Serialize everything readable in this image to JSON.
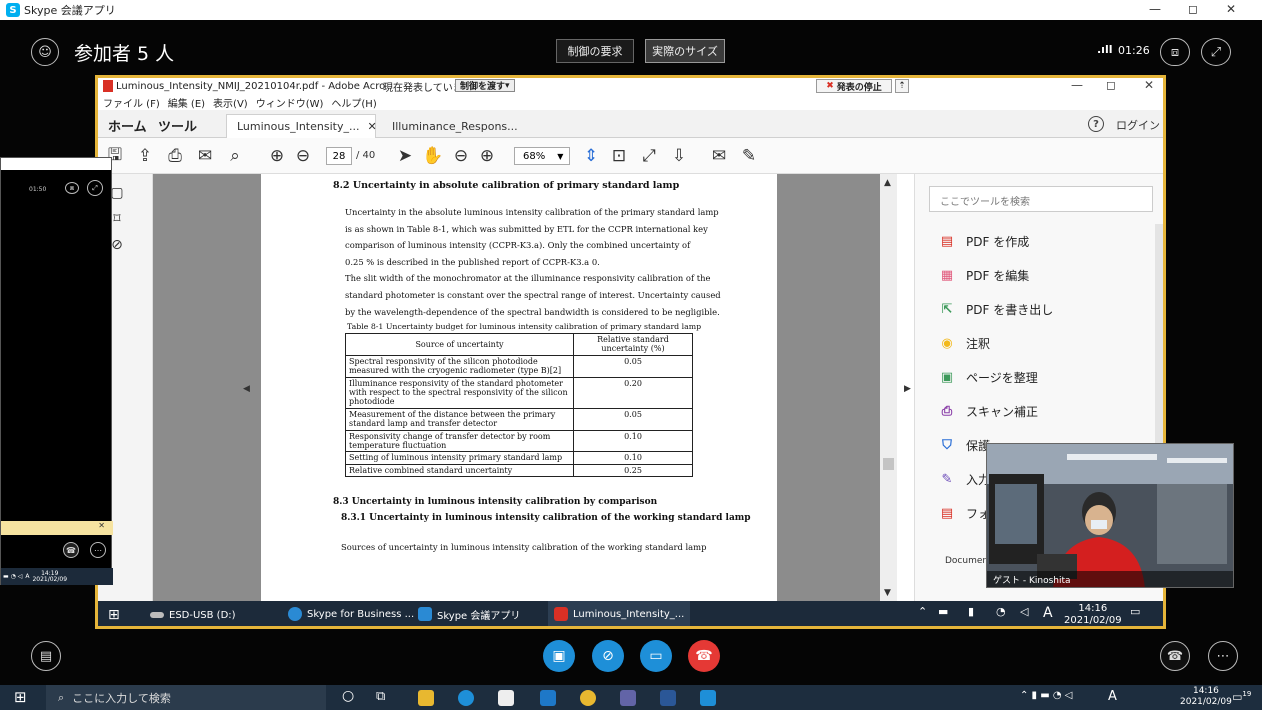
{
  "skype": {
    "window_title": "Skype 会議アプリ",
    "window_controls": {
      "minimize": "—",
      "maximize": "◻",
      "close": "✕"
    },
    "participants_label": "参加者 5 人",
    "request_control": "制御の要求",
    "actual_size": "実際のサイズ",
    "signal": ".ıll",
    "call_timer": "01:26"
  },
  "acrobat": {
    "title": "Luminous_Intensity_NMIJ_20210104r.pdf - Adobe Acro",
    "presenting": "現在発表しています",
    "hand_over": "制御を渡す",
    "stop_presenting": "発表の停止",
    "stop_x": "✖",
    "menu": [
      "ファイル (F)",
      "編集 (E)",
      "表示(V)",
      "ウィンドウ(W)",
      "ヘルプ(H)"
    ],
    "tab_home": "ホーム",
    "tab_tools": "ツール",
    "doc_tabs": [
      "Luminous_Intensity_...",
      "Illuminance_Respons..."
    ],
    "login": "ログイン",
    "page_current": "28",
    "page_total": "/ 40",
    "zoom": "68%",
    "tools_search_placeholder": "ここでツールを検索",
    "tools": [
      {
        "label": "PDF を作成",
        "icon": "create-pdf-icon",
        "color": "#d93025",
        "glyph": "▤"
      },
      {
        "label": "PDF を編集",
        "icon": "edit-pdf-icon",
        "color": "#e0567a",
        "glyph": "▦"
      },
      {
        "label": "PDF を書き出し",
        "icon": "export-pdf-icon",
        "color": "#3d9a5b",
        "glyph": "⇱"
      },
      {
        "label": "注釈",
        "icon": "comment-icon",
        "color": "#f2b91c",
        "glyph": "◉"
      },
      {
        "label": "ページを整理",
        "icon": "organize-pages-icon",
        "color": "#3d9a5b",
        "glyph": "▣"
      },
      {
        "label": "スキャン補正",
        "icon": "scan-icon",
        "color": "#8a3ea8",
        "glyph": "⎙"
      },
      {
        "label": "保護",
        "icon": "protect-icon",
        "color": "#2b6fd6",
        "glyph": "⛉"
      },
      {
        "label": "入力",
        "icon": "fill-sign-icon",
        "color": "#6a4ab8",
        "glyph": "✎"
      },
      {
        "label": "フォ",
        "icon": "form-icon",
        "color": "#d93025",
        "glyph": "▤"
      }
    ],
    "document_cloud_label": "Documen"
  },
  "pdf": {
    "section_82": "8.2 Uncertainty in absolute calibration of primary standard lamp",
    "para_lines": [
      "Uncertainty in the absolute luminous intensity calibration of the primary standard lamp",
      "is as shown in Table 8-1, which was submitted by ETL for the CCPR international key",
      "comparison of luminous intensity (CCPR-K3.a). Only the combined uncertainty of",
      "0.25 % is described in the published report of CCPR-K3.a 0.",
      "The slit width of the monochromator at the illuminance responsivity calibration of the",
      "standard photometer is constant over the spectral range of interest. Uncertainty caused",
      "by the wavelength-dependence of the spectral bandwidth is considered to be negligible."
    ],
    "table_caption": "Table 8-1 Uncertainty budget for luminous intensity calibration of primary standard lamp",
    "table_head": [
      "Source of uncertainty",
      "Relative standard uncertainty (%)"
    ],
    "table_rows": [
      [
        "Spectral responsivity of the silicon photodiode measured with the cryogenic radiometer (type B)[2]",
        "0.05"
      ],
      [
        "Illuminance responsivity of the standard photometer with respect to the spectral responsivity of the silicon photodiode",
        "0.20"
      ],
      [
        "Measurement of the distance between the primary standard lamp and transfer detector",
        "0.05"
      ],
      [
        "Responsivity change of transfer detector by room temperature fluctuation",
        "0.10"
      ],
      [
        "Setting of luminous intensity primary standard lamp",
        "0.10"
      ],
      [
        "Relative combined standard uncertainty",
        "0.25"
      ]
    ],
    "section_83": "8.3 Uncertainty in luminous intensity calibration by comparison",
    "section_831": "8.3.1 Uncertainty in luminous intensity calibration of the working standard lamp",
    "para_831": "Sources of uncertainty in luminous intensity calibration of the working standard lamp"
  },
  "remote_taskbar": {
    "items": [
      "ESD-USB (D:)",
      "Skype for Business ...",
      "Skype 会議アプリ",
      "Luminous_Intensity_..."
    ],
    "ime": "A",
    "time": "14:16",
    "date": "2021/02/09"
  },
  "video": {
    "name": "ゲスト - Kinoshita"
  },
  "mini": {
    "time": "01:50",
    "clock_time": "14:19",
    "clock_date": "2021/02/09",
    "ime": "A"
  },
  "os_taskbar": {
    "search_placeholder": "ここに入力して検索",
    "ime": "A",
    "time": "14:16",
    "date": "2021/02/09",
    "notifications": "19"
  }
}
